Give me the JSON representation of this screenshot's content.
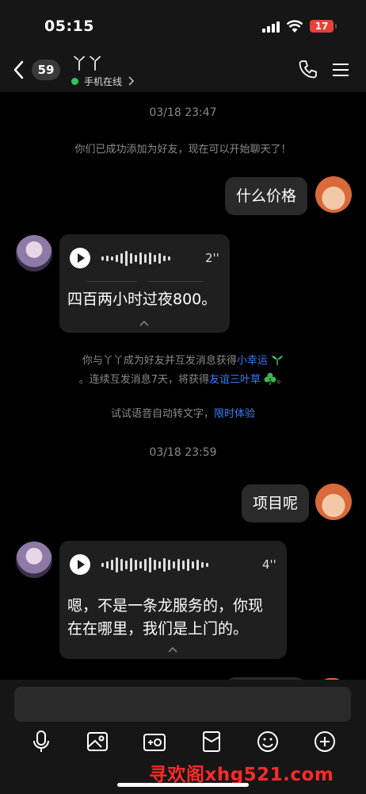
{
  "status_bar": {
    "time": "05:15",
    "battery": "17"
  },
  "header": {
    "unread_count": "59",
    "contact_name": "丫丫",
    "online_status": "手机在线"
  },
  "messages": {
    "timestamp_1": "03/18 23:47",
    "friend_added": "你们已成功添加为好友，现在可以开始聊天了！",
    "me_1": "什么价格",
    "voice_1": {
      "duration": "2''",
      "transcript": "四百两小时过夜800。"
    },
    "luck_line1_prefix": "你与丫丫成为好友并互发消息获得",
    "luck_line1_link": "小幸运",
    "luck_line2_prefix": "。连续互发消息7天，将获得",
    "luck_line2_link": "友谊三叶草",
    "luck_line2_suffix": "。",
    "voice_tip": "试试语音自动转文字，",
    "voice_tip_link": "限时体验",
    "timestamp_2": "03/18 23:59",
    "me_2": "项目呢",
    "voice_2": {
      "duration": "4''",
      "transcript_line1": "嗯，不是一条龙服务的，你现",
      "transcript_line2": "在在哪里，我们是上门的。"
    }
  },
  "toolbar": {
    "icons": [
      "microphone-icon",
      "image-icon",
      "camera-icon",
      "red-packet-icon",
      "emoji-icon",
      "plus-icon"
    ]
  },
  "watermark": "寻欢阁xhg521.com",
  "colors": {
    "link": "#3b7cf6",
    "battery": "#e8413a",
    "online": "#2fc25b",
    "watermark": "#ff2a2a"
  }
}
